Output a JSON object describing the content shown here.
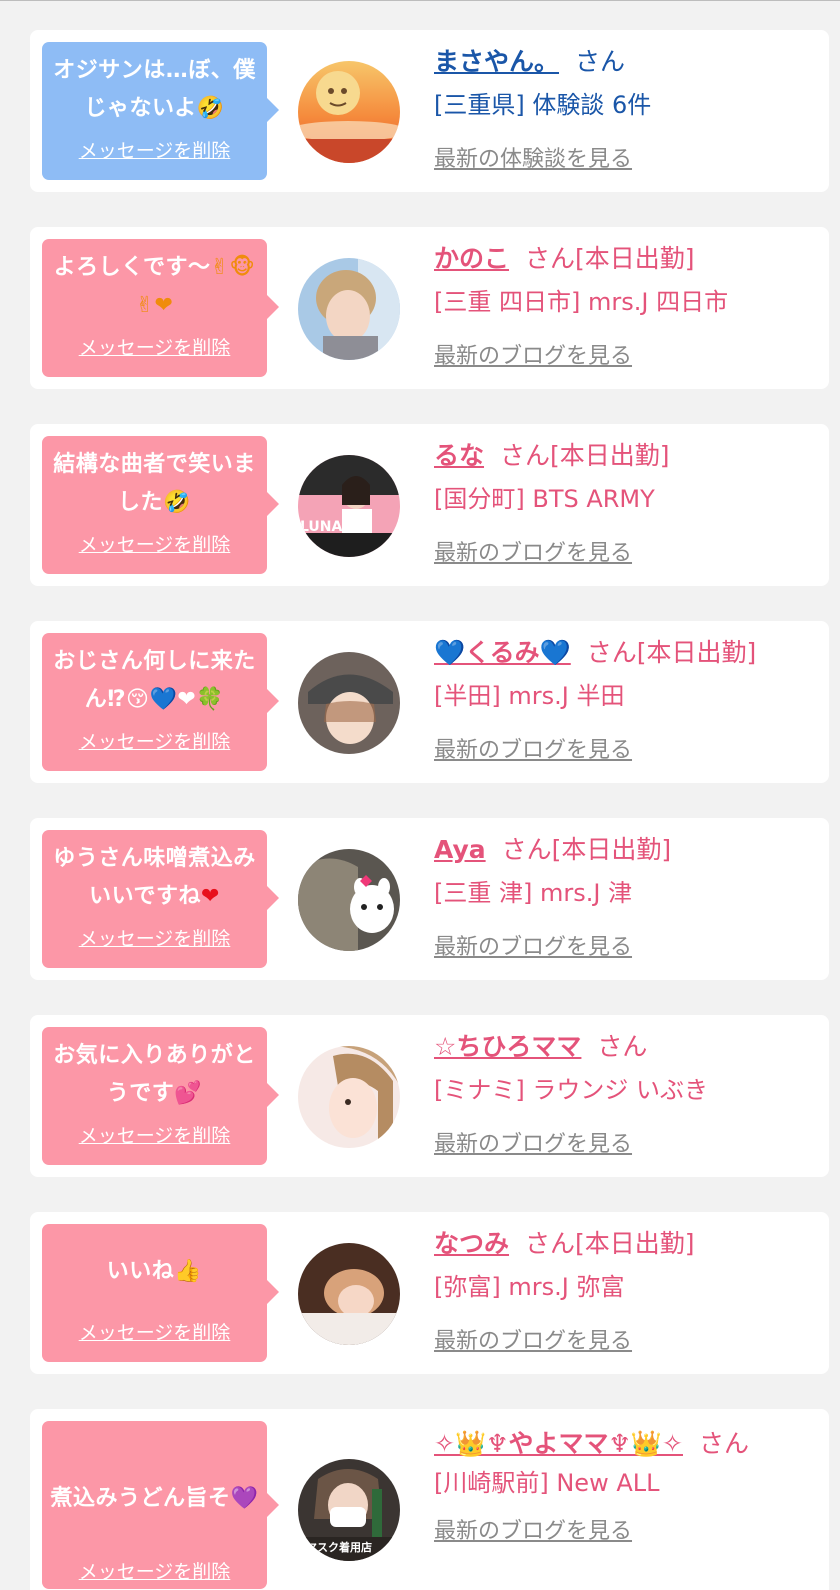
{
  "items": [
    {
      "message_text": "オジサンは…ぼ、僕じゃないよ",
      "message_emoji": "🤣",
      "delete_label": "メッセージを削除",
      "name": "まさやん。",
      "san": "さん",
      "status": "",
      "shop": "[三重県] 体験談 6件",
      "link": "最新の体験談を見る",
      "theme": "blue",
      "avatar": "sunset-face-photo"
    },
    {
      "message_text": "よろしくです〜",
      "message_emoji": "✌🐵✌❤",
      "delete_label": "メッセージを削除",
      "name": "かのこ",
      "san": "さん",
      "status": "[本日出勤]",
      "shop": "[三重 四日市] mrs.J 四日市",
      "link": "最新のブログを見る",
      "theme": "pink",
      "avatar": "blonde-woman-photo"
    },
    {
      "message_text": "結構な曲者で笑いました",
      "message_emoji": "🤣",
      "delete_label": "メッセージを削除",
      "name": "るな",
      "san": "さん",
      "status": "[本日出勤]",
      "shop": "[国分町] BTS ARMY",
      "link": "最新のブログを見る",
      "theme": "pink",
      "avatar": "luna-photo",
      "avatar_text": "LUNA"
    },
    {
      "message_text": "おじさん何しに来たん",
      "message_emoji": "⁉😚💙❤🍀",
      "delete_label": "メッセージを削除",
      "name": "💙くるみ💙",
      "san": "さん",
      "status": "[本日出勤]",
      "shop": "[半田] mrs.J 半田",
      "link": "最新のブログを見る",
      "theme": "pink",
      "avatar": "hat-woman-photo"
    },
    {
      "message_text": "ゆうさん味噌煮込みいいですね",
      "message_emoji": "❤",
      "delete_label": "メッセージを削除",
      "name": "Aya",
      "san": "さん",
      "status": "[本日出勤]",
      "shop": "[三重 津] mrs.J 津",
      "link": "最新のブログを見る",
      "theme": "pink",
      "avatar": "sticker-face-photo"
    },
    {
      "message_text": "お気に入りありがとうです",
      "message_emoji": "💕",
      "delete_label": "メッセージを削除",
      "name": "☆ちひろママ",
      "san": "さん",
      "status": "",
      "shop": "[ミナミ] ラウンジ いぶき",
      "link": "最新のブログを見る",
      "theme": "pink",
      "avatar": "blonde-selfie-photo"
    },
    {
      "message_text": "いいね",
      "message_emoji": "👍",
      "delete_label": "メッセージを削除",
      "name": "なつみ",
      "san": "さん",
      "status": "[本日出勤]",
      "shop": "[弥富] mrs.J 弥富",
      "link": "最新のブログを見る",
      "theme": "pink",
      "avatar": "reclining-woman-photo"
    },
    {
      "message_text": "煮込みうどん旨そ",
      "message_emoji": "💜",
      "delete_label": "メッセージを削除",
      "name": "✧👑♆やよママ♆👑✧",
      "san": "さん",
      "status": "",
      "shop": "[川崎駅前] New ALL",
      "link": "最新のブログを見る",
      "theme": "pink",
      "avatar": "masked-woman-photo",
      "avatar_text": "マスク着用店"
    }
  ]
}
